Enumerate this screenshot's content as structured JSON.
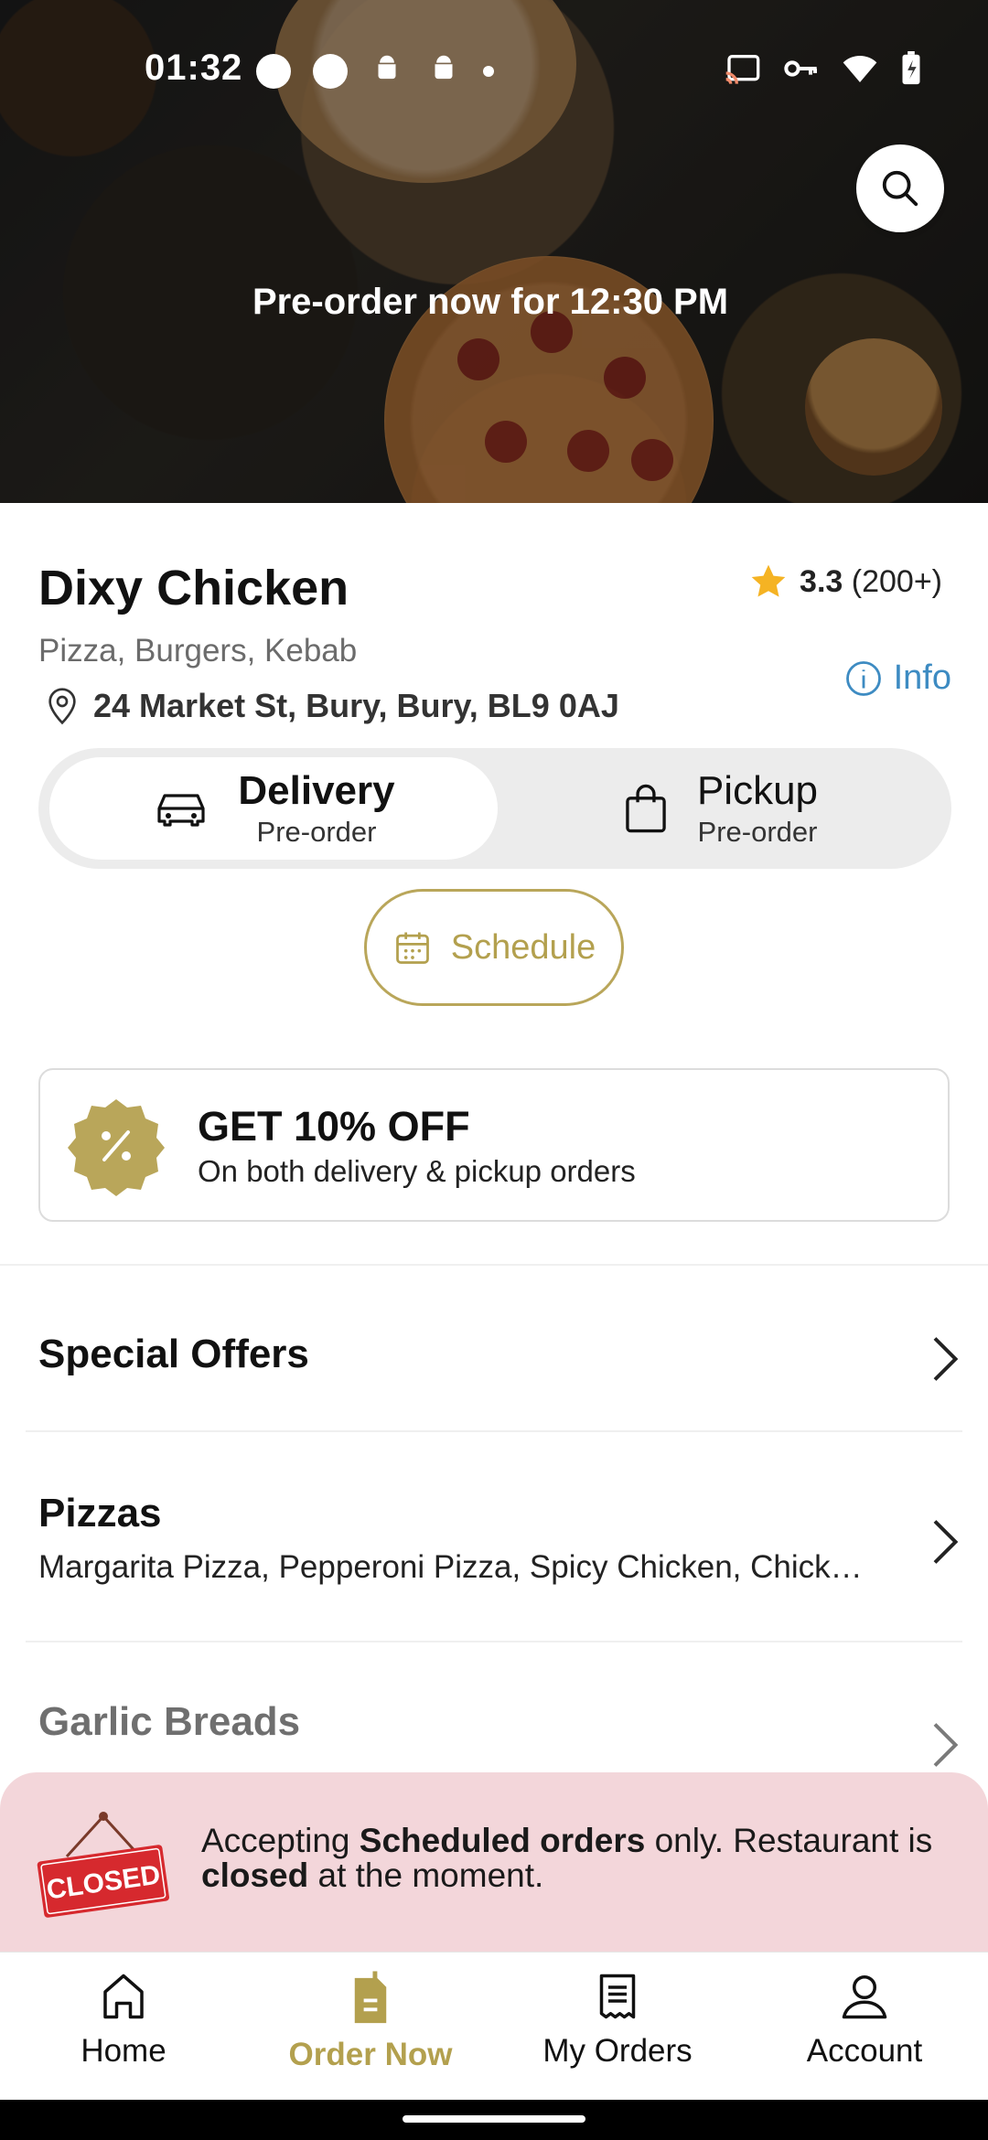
{
  "status_bar": {
    "time": "01:32"
  },
  "hero": {
    "preorder_message": "Pre-order now for 12:30 PM"
  },
  "restaurant": {
    "name": "Dixy Chicken",
    "rating": "3.3",
    "rating_count": "(200+)",
    "cuisines": "Pizza, Burgers, Kebab",
    "address": "24 Market St, Bury, Bury, BL9 0AJ",
    "info_label": "Info"
  },
  "order_mode": {
    "delivery_label": "Delivery",
    "delivery_sub": "Pre-order",
    "pickup_label": "Pickup",
    "pickup_sub": "Pre-order",
    "selected": "Delivery"
  },
  "schedule_label": "Schedule",
  "promo": {
    "title": "GET 10% OFF",
    "subtitle": "On both delivery & pickup orders"
  },
  "categories": [
    {
      "title": "Special Offers",
      "desc": ""
    },
    {
      "title": "Pizzas",
      "desc": "Margarita Pizza, Pepperoni Pizza, Spicy Chicken, Chick…"
    },
    {
      "title": "Garlic Breads",
      "desc": ""
    }
  ],
  "closed_banner": {
    "sign_text": "CLOSED",
    "part1": "Accepting ",
    "bold1": "Scheduled orders",
    "part2": " only. Restaurant is ",
    "bold2": "closed",
    "part3": " at the moment."
  },
  "bottom_nav": {
    "items": [
      {
        "label": "Home",
        "icon": "home-icon"
      },
      {
        "label": "Order Now",
        "icon": "order-icon"
      },
      {
        "label": "My Orders",
        "icon": "receipt-icon"
      },
      {
        "label": "Account",
        "icon": "person-icon"
      }
    ],
    "active": "Order Now"
  },
  "colors": {
    "accent_gold": "#b3a04e",
    "info_blue": "#3d8bc2",
    "star": "#f5b323",
    "closed_banner_bg": "#f3d6da",
    "closed_sign_red": "#d6292e"
  }
}
